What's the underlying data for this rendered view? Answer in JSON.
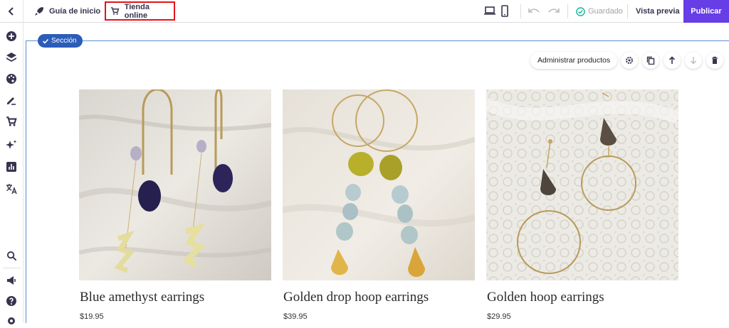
{
  "topbar": {
    "guide_label": "Guía de inicio",
    "store_label": "Tienda online",
    "saved_label": "Guardado",
    "preview_label": "Vista previa",
    "publish_label": "Publicar"
  },
  "section": {
    "badge_label": "Sección"
  },
  "toolbar": {
    "manage_products_label": "Administrar productos"
  },
  "products": [
    {
      "title": "Blue amethyst earrings",
      "price": "$19.95"
    },
    {
      "title": "Golden drop hoop earrings",
      "price": "$39.95"
    },
    {
      "title": "Golden hoop earrings",
      "price": "$29.95"
    }
  ],
  "sidebar": {
    "icons": [
      "add-icon",
      "layers-icon",
      "palette-icon",
      "edit-icon",
      "cart-icon",
      "ai-sparkle-icon",
      "analytics-icon",
      "translate-icon",
      "search-icon",
      "marketing-icon",
      "help-icon",
      "settings-icon"
    ]
  },
  "colors": {
    "accent": "#673de6",
    "section_badge": "#2b5cb8",
    "highlight_border": "#e0141b"
  }
}
